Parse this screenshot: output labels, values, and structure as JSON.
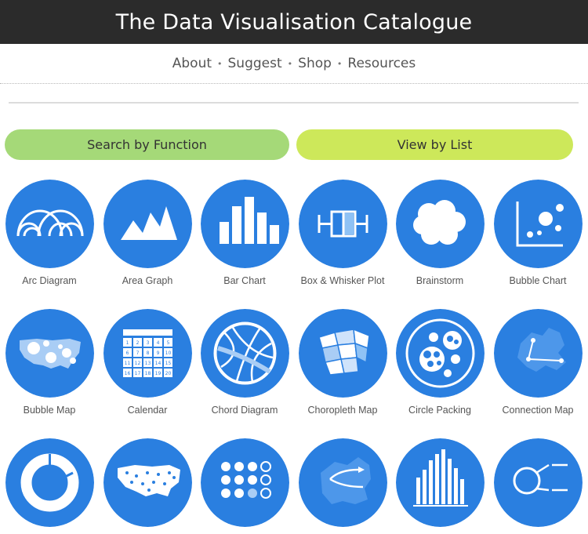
{
  "site": {
    "title": "The Data Visualisation Catalogue"
  },
  "nav": {
    "items": [
      "About",
      "Suggest",
      "Shop",
      "Resources"
    ]
  },
  "buttons": {
    "search_by_function": "Search by Function",
    "view_by_list": "View by List"
  },
  "colors": {
    "header_bg": "#2b2b2b",
    "circle_blue": "#2a7fe0",
    "button_green": "#a5d978",
    "button_lime": "#cde85a"
  },
  "tiles": [
    {
      "label": "Arc Diagram",
      "icon": "arc-diagram-icon"
    },
    {
      "label": "Area Graph",
      "icon": "area-graph-icon"
    },
    {
      "label": "Bar Chart",
      "icon": "bar-chart-icon"
    },
    {
      "label": "Box & Whisker Plot",
      "icon": "box-whisker-icon"
    },
    {
      "label": "Brainstorm",
      "icon": "brainstorm-icon"
    },
    {
      "label": "Bubble Chart",
      "icon": "bubble-chart-icon"
    },
    {
      "label": "Bubble Map",
      "icon": "bubble-map-icon"
    },
    {
      "label": "Calendar",
      "icon": "calendar-icon"
    },
    {
      "label": "Chord Diagram",
      "icon": "chord-diagram-icon"
    },
    {
      "label": "Choropleth Map",
      "icon": "choropleth-map-icon"
    },
    {
      "label": "Circle Packing",
      "icon": "circle-packing-icon"
    },
    {
      "label": "Connection Map",
      "icon": "connection-map-icon"
    },
    {
      "label": "",
      "icon": "donut-chart-icon"
    },
    {
      "label": "",
      "icon": "dot-map-icon"
    },
    {
      "label": "",
      "icon": "dot-matrix-icon"
    },
    {
      "label": "",
      "icon": "flow-map-icon"
    },
    {
      "label": "",
      "icon": "histogram-icon"
    },
    {
      "label": "",
      "icon": "illustration-diagram-icon"
    }
  ],
  "calendar_numbers": [
    "1",
    "2",
    "3",
    "4",
    "5",
    "6",
    "7",
    "8",
    "9",
    "10",
    "11",
    "12",
    "13",
    "14",
    "15",
    "16",
    "17",
    "18",
    "19",
    "20"
  ]
}
